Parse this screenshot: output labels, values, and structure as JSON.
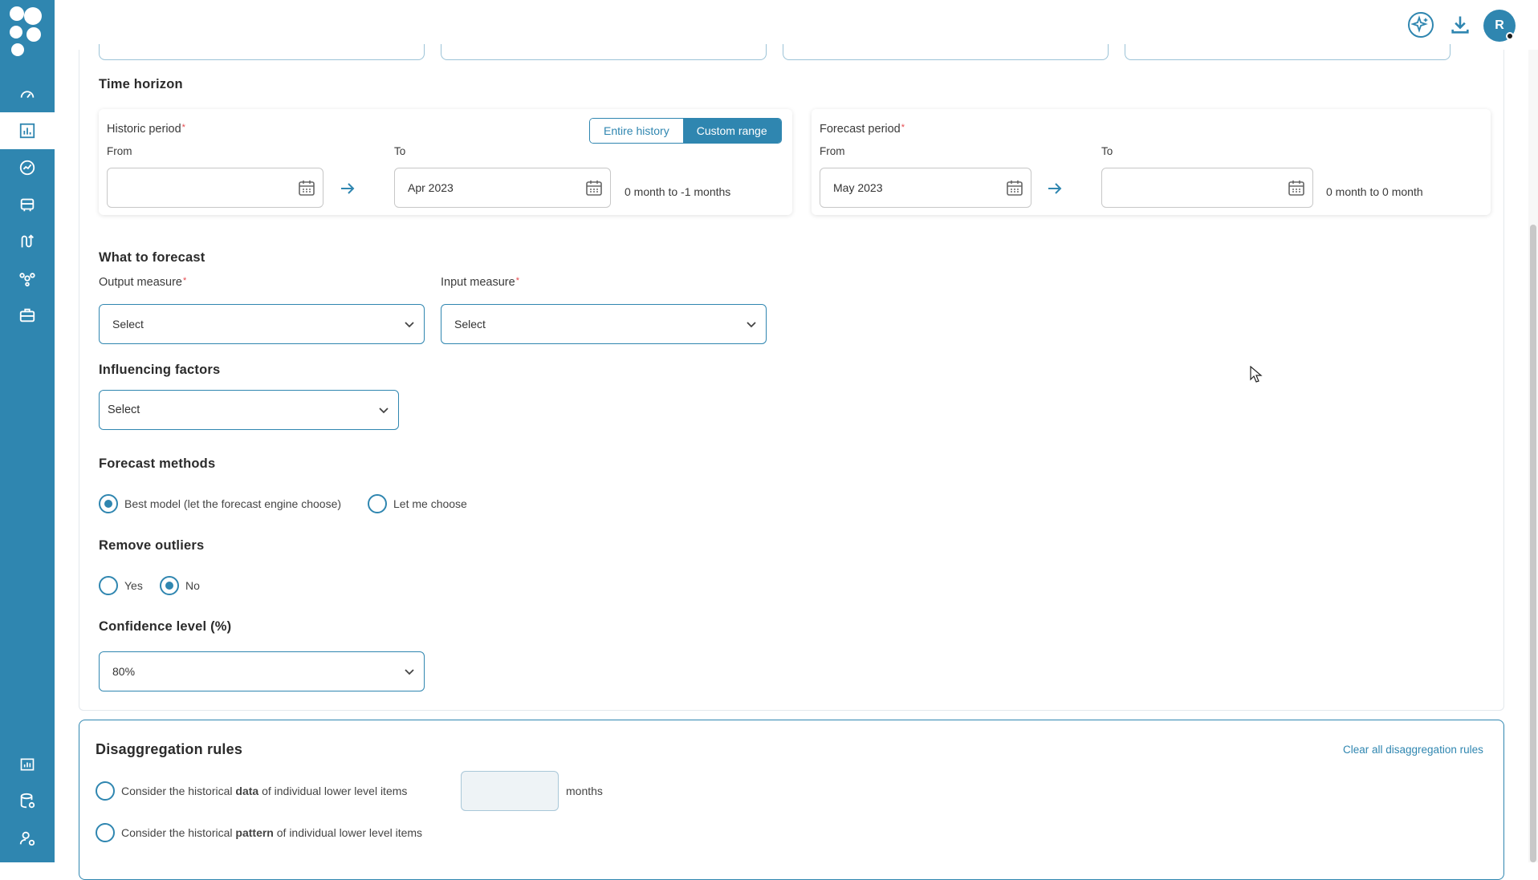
{
  "sidebar": {
    "items": [
      {
        "icon": "dashboard-gauge-icon",
        "active": false
      },
      {
        "icon": "bar-chart-icon",
        "active": true
      },
      {
        "icon": "trend-circle-icon",
        "active": false
      },
      {
        "icon": "briefcase-icon",
        "active": false
      },
      {
        "icon": "flow-icon",
        "active": false
      },
      {
        "icon": "network-icon",
        "active": false
      },
      {
        "icon": "toolbox-icon",
        "active": false
      },
      {
        "icon": "report-icon",
        "active": false
      },
      {
        "icon": "database-settings-icon",
        "active": false
      },
      {
        "icon": "user-settings-icon",
        "active": false
      }
    ]
  },
  "topbar": {
    "avatar_initial": "R",
    "icons": [
      "ai-sparkle-icon",
      "download-icon"
    ]
  },
  "time_horizon": {
    "title": "Time horizon",
    "historic": {
      "label": "Historic period",
      "required_mark": "*",
      "from_label": "From",
      "to_label": "To",
      "from_value": "",
      "to_value": "Apr 2023",
      "range_text": "0 month to -1 months",
      "toggle": {
        "option_a": "Entire history",
        "option_b": "Custom range",
        "selected": "Custom range"
      }
    },
    "forecast": {
      "label": "Forecast period",
      "required_mark": "*",
      "from_label": "From",
      "to_label": "To",
      "from_value": "May 2023",
      "to_value": "",
      "range_text": "0 month to 0 month"
    }
  },
  "what_to_forecast": {
    "title": "What to forecast",
    "output_label": "Output measure",
    "output_value": "Select",
    "input_label": "Input measure",
    "input_value": "Select",
    "required_mark": "*"
  },
  "influencing": {
    "title": "Influencing factors",
    "value": "Select"
  },
  "forecast_methods": {
    "title": "Forecast methods",
    "option_best": "Best model (let the forecast engine choose)",
    "option_choose": "Let me choose",
    "selected": "best"
  },
  "remove_outliers": {
    "title": "Remove outliers",
    "option_yes": "Yes",
    "option_no": "No",
    "selected": "no"
  },
  "confidence": {
    "title": "Confidence level (%)",
    "value": "80%"
  },
  "disaggregation": {
    "title": "Disaggregation rules",
    "clear_link": "Clear all disaggregation rules",
    "rule1_pre": "Consider the historical ",
    "rule1_bold": "data",
    "rule1_post": " of individual lower level items",
    "months_value": "",
    "months_label": "months",
    "rule2_pre": "Consider the historical ",
    "rule2_bold": "pattern",
    "rule2_post": " of individual lower level items"
  },
  "colors": {
    "primary": "#2f86b0",
    "required": "#e5484d"
  }
}
